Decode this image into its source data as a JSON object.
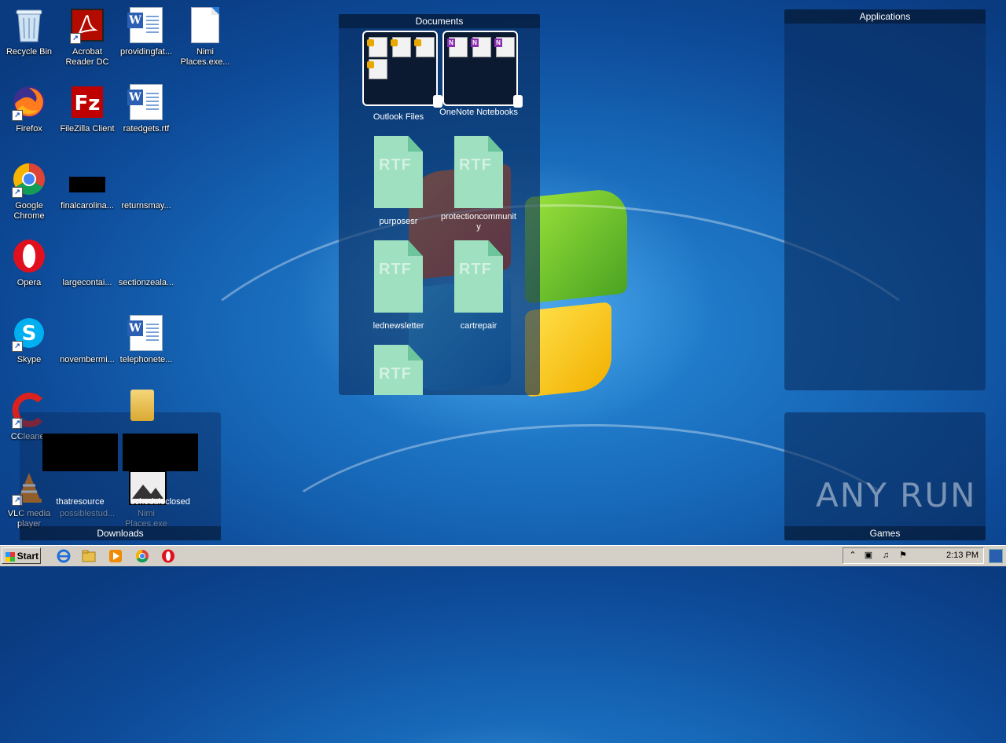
{
  "desktop": {
    "icons": [
      {
        "label": "Recycle Bin",
        "icon": "recycle-bin-icon"
      },
      {
        "label": "Acrobat Reader DC",
        "icon": "acrobat-icon"
      },
      {
        "label": "providingfat...",
        "icon": "word-doc-icon"
      },
      {
        "label": "Nimi Places.exe...",
        "icon": "blank-file-icon"
      },
      {
        "label": "Firefox",
        "icon": "firefox-icon"
      },
      {
        "label": "FileZilla Client",
        "icon": "filezilla-icon"
      },
      {
        "label": "ratedgets.rtf",
        "icon": "word-doc-icon"
      },
      {
        "label": "Google Chrome",
        "icon": "chrome-icon"
      },
      {
        "label": "finalcarolina...",
        "icon": "redacted-icon"
      },
      {
        "label": "returnsmay...",
        "icon": "blank-icon"
      },
      {
        "label": "Opera",
        "icon": "opera-icon"
      },
      {
        "label": "largecontai...",
        "icon": "blank-icon"
      },
      {
        "label": "sectionzeala...",
        "icon": "blank-icon"
      },
      {
        "label": "Skype",
        "icon": "skype-icon"
      },
      {
        "label": "novembermi...",
        "icon": "blank-icon"
      },
      {
        "label": "telephonete...",
        "icon": "word-doc-icon"
      },
      {
        "label": "CCleaner",
        "icon": "ccleaner-icon"
      },
      {
        "label": "VLC media player",
        "icon": "vlc-icon"
      },
      {
        "label": "possiblestud...",
        "icon": "blank-icon"
      },
      {
        "label": "Nimi Places.exe",
        "icon": "blank-icon"
      }
    ]
  },
  "fences": {
    "documents": {
      "title": "Documents",
      "folders": [
        {
          "label": "Outlook Files"
        },
        {
          "label": "OneNote Notebooks"
        }
      ],
      "files": [
        {
          "label": "purposesr",
          "badge": "RTF"
        },
        {
          "label": "protectioncommunity",
          "badge": "RTF"
        },
        {
          "label": "lednewsletter",
          "badge": "RTF"
        },
        {
          "label": "cartrepair",
          "badge": "RTF"
        },
        {
          "label": "",
          "badge": "RTF"
        }
      ]
    },
    "applications": {
      "title": "Applications"
    },
    "games": {
      "title": "Games"
    },
    "downloads": {
      "title": "Downloads",
      "items": [
        {
          "label": "thatresource"
        },
        {
          "label": "scheduleclosed"
        }
      ]
    }
  },
  "watermark": "ANY RUN",
  "taskbar": {
    "start_label": "Start",
    "quick_launch": [
      "internet-explorer-icon",
      "explorer-icon",
      "media-player-icon",
      "chrome-icon",
      "opera-icon"
    ],
    "clock": "2:13 PM"
  }
}
